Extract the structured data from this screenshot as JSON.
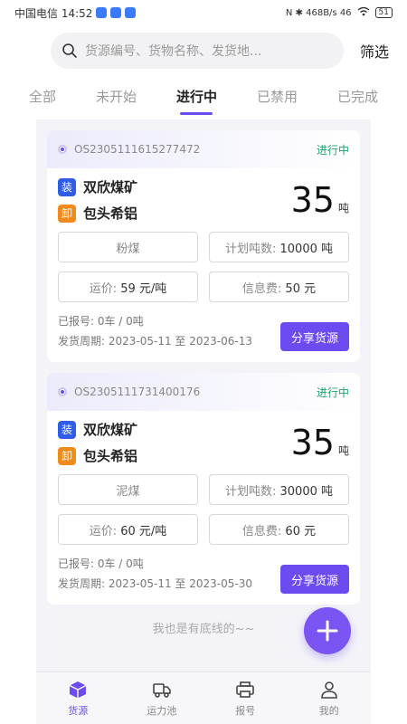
{
  "status_bar": {
    "carrier_time": "中国电信 14:52",
    "right_info": "N ✱ 468B/s 46 ",
    "battery": "51"
  },
  "search": {
    "placeholder": "货源编号、货物名称、发货地...",
    "filter_label": "筛选"
  },
  "tabs": [
    {
      "label": "全部"
    },
    {
      "label": "未开始"
    },
    {
      "label": "进行中"
    },
    {
      "label": "已禁用"
    },
    {
      "label": "已完成"
    }
  ],
  "cards": [
    {
      "order_no": "OS2305111615277472",
      "status": "进行中",
      "load_tag": "装",
      "load_place": "双欣煤矿",
      "unload_tag": "卸",
      "unload_place": "包头希铝",
      "qty": "35",
      "qty_unit": "吨",
      "cargo": "粉煤",
      "plan_label": "计划吨数:",
      "plan_value": "10000 吨",
      "price_label": "运价:",
      "price_value": "59 元/吨",
      "fee_label": "信息费:",
      "fee_value": "50 元",
      "reported": "已报号: 0车 / 0吨",
      "period": "发货周期: 2023-05-11 至 2023-06-13",
      "share_label": "分享货源"
    },
    {
      "order_no": "OS2305111731400176",
      "status": "进行中",
      "load_tag": "装",
      "load_place": "双欣煤矿",
      "unload_tag": "卸",
      "unload_place": "包头希铝",
      "qty": "35",
      "qty_unit": "吨",
      "cargo": "泥煤",
      "plan_label": "计划吨数:",
      "plan_value": "30000 吨",
      "price_label": "运价:",
      "price_value": "60 元/吨",
      "fee_label": "信息费:",
      "fee_value": "60 元",
      "reported": "已报号: 0车 / 0吨",
      "period": "发货周期: 2023-05-11 至 2023-05-30",
      "share_label": "分享货源"
    }
  ],
  "end_text": "我也是有底线的~~",
  "bottom_nav": [
    {
      "label": "货源",
      "icon": "box-icon"
    },
    {
      "label": "运力池",
      "icon": "truck-icon"
    },
    {
      "label": "报号",
      "icon": "printer-icon"
    },
    {
      "label": "我的",
      "icon": "user-icon"
    }
  ],
  "colors": {
    "accent": "#6c4cf1",
    "status_green": "#1aa56a",
    "load_blue": "#2f5ce8",
    "unload_orange": "#f08a1d"
  }
}
